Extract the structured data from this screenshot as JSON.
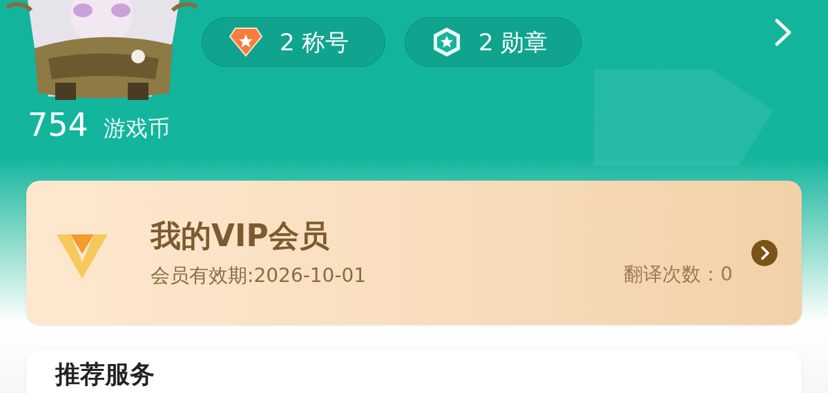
{
  "profile": {
    "badges": [
      {
        "kind": "title",
        "label": "2 称号"
      },
      {
        "kind": "medal",
        "label": "2 勋章"
      }
    ],
    "coins": {
      "value": "754",
      "label": "游戏币"
    }
  },
  "vip": {
    "title": "我的VIP会员",
    "expiry": "会员有效期:2026-10-01",
    "translations": "翻译次数：0"
  },
  "services": {
    "title": "推荐服务"
  }
}
